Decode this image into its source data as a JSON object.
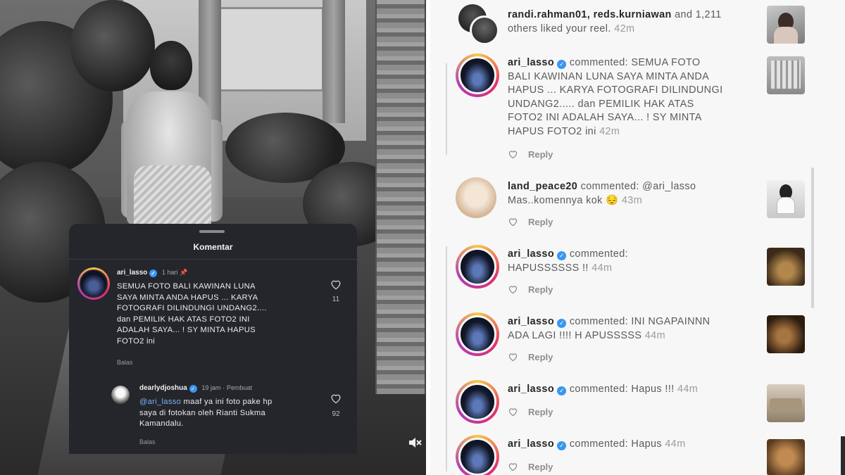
{
  "left": {
    "sheet_title": "Komentar",
    "comments": [
      {
        "user": "ari_lasso",
        "time": "1 hari",
        "text_lines": [
          "SEMUA FOTO BALI KAWINAN LUNA",
          "SAYA MINTA ANDA HAPUS ... KARYA",
          "FOTOGRAFI DILINDUNGI UNDANG2....",
          "dan PEMILIK HAK ATAS FOTO2 INI",
          "ADALAH SAYA... ! SY MINTA HAPUS",
          "FOTO2 ini"
        ],
        "reply_label": "Balas",
        "likes": "11"
      },
      {
        "user": "dearlydjoshua",
        "time": "19 jam",
        "meta_sep": "·",
        "creator_tag": "Pembuat",
        "mention": "@ari_lasso",
        "text_first": " maaf ya ini foto pake hp",
        "text_lines": [
          "saya di fotokan oleh Rianti Sukma",
          "Kamandalu."
        ],
        "reply_label": "Balas",
        "likes": "92"
      }
    ]
  },
  "right": {
    "notifications": [
      {
        "users": "randi.rahman01, reds.kurniawan",
        "text_line1_rest": " and 1,211",
        "text_line2": "others liked your reel.",
        "time": "42m"
      },
      {
        "user": "ari_lasso",
        "verb": " commented: SEMUA FOTO",
        "lines": [
          "BALI KAWINAN LUNA SAYA MINTA ANDA",
          "HAPUS ... KARYA FOTOGRAFI DILINDUNGI",
          "UNDANG2..... dan PEMILIK HAK ATAS",
          "FOTO2 INI ADALAH SAYA... ! SY MINTA",
          "HAPUS FOTO2 ini"
        ],
        "time": "42m",
        "reply": "Reply"
      },
      {
        "user": "land_peace20",
        "verb": " commented: @ari_lasso",
        "lines": [
          "Mas..komennya kok 😔"
        ],
        "time": "43m",
        "reply": "Reply"
      },
      {
        "user": "ari_lasso",
        "verb": " commented:",
        "lines": [
          "HAPUSSSSSS !!"
        ],
        "time": "44m",
        "reply": "Reply"
      },
      {
        "user": "ari_lasso",
        "verb": " commented: INI NGAPAINNN",
        "lines": [
          "ADA LAGI !!!! H APUSSSSS"
        ],
        "time": "44m",
        "reply": "Reply"
      },
      {
        "user": "ari_lasso",
        "verb": " commented: Hapus !!!",
        "lines": [],
        "time": "44m",
        "reply": "Reply"
      },
      {
        "user": "ari_lasso",
        "verb": " commented: Hapus",
        "lines": [],
        "time": "44m",
        "reply": "Reply"
      }
    ]
  },
  "icons": {
    "heart": "heart-icon",
    "verified": "verified-badge-icon",
    "pin": "pin-icon",
    "mute": "speaker-muted-icon"
  }
}
